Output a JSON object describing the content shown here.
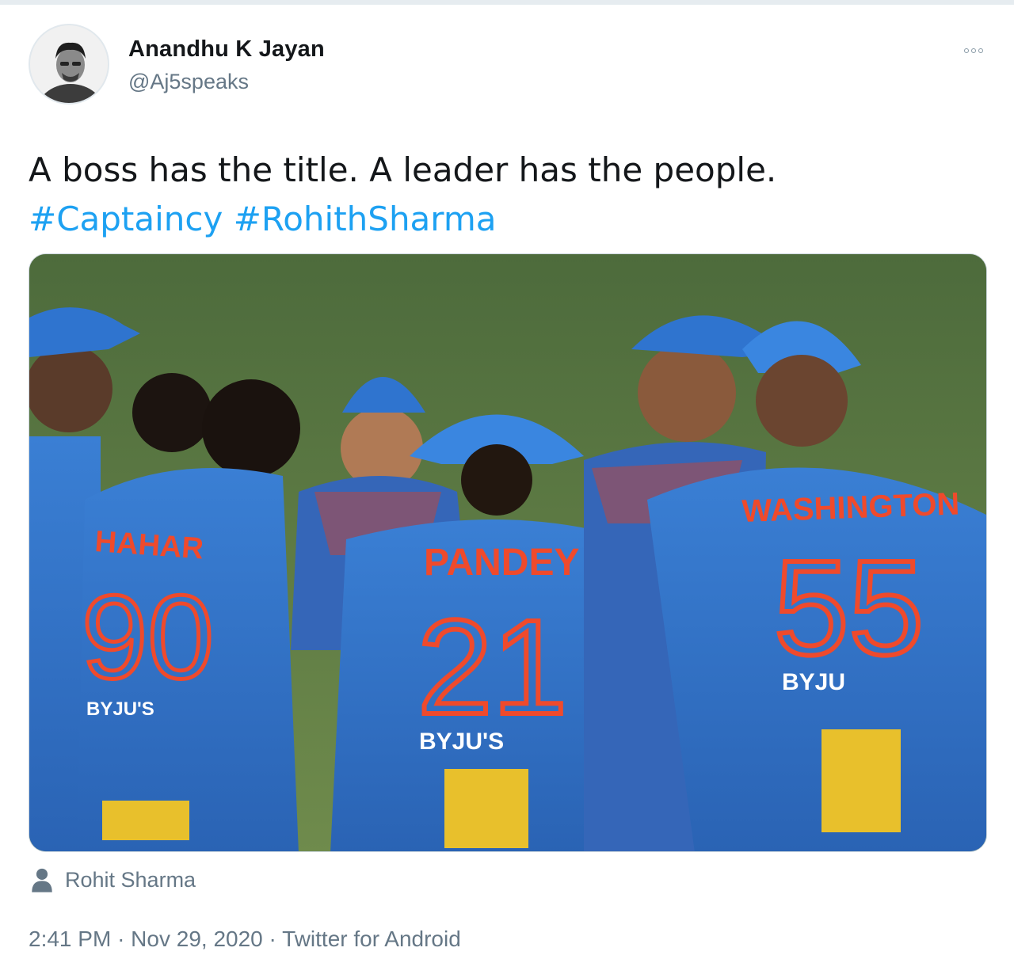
{
  "tweet": {
    "author": {
      "display_name": "Anandhu K Jayan",
      "handle": "@Aj5speaks"
    },
    "text_line1": "A boss has the title. A leader has the people.",
    "hashtags": [
      "#Captaincy",
      "#RohithSharma"
    ],
    "media": {
      "jerseys": [
        {
          "name": "HAHAR",
          "number": "90",
          "sponsor": "BYJU'S"
        },
        {
          "name": "PANDEY",
          "number": "21",
          "sponsor": "BYJU'S"
        },
        {
          "name": "WASHINGTON",
          "number": "55",
          "sponsor": "BYJU"
        }
      ]
    },
    "tagged_user": "Rohit Sharma",
    "timestamp": "2:41 PM",
    "date": "Nov 29, 2020",
    "source": "Twitter for Android",
    "separator": "·"
  },
  "colors": {
    "hashtag": "#1da1f2",
    "secondary_text": "#657786",
    "primary_text": "#14171a",
    "jersey_blue": "#2f6fc4",
    "jersey_number": "#ef4a2c",
    "pitch": "#5f7d45"
  }
}
